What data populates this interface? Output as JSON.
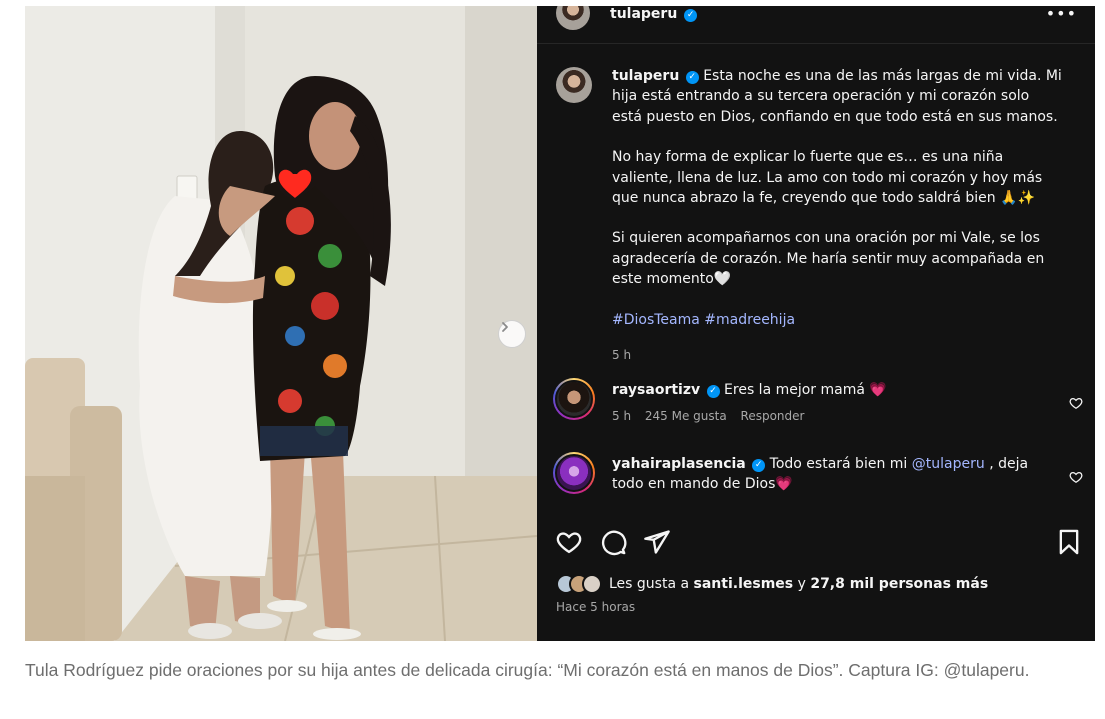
{
  "post": {
    "username": "tulaperu",
    "more_icon": "more-horizontal-icon",
    "caption": {
      "p1": "Esta noche es una de las más largas de mi vida. Mi hija está entrando a su tercera operación y mi corazón solo está puesto en Dios, confiando en que todo está en sus manos.",
      "p2": "No hay forma de explicar lo fuerte que es… es una niña valiente, llena de luz. La amo con todo mi corazón y hoy más que nunca abrazo la fe, creyendo que todo saldrá bien 🙏✨",
      "p3": "Si quieren acompañarnos con una oración por mi Vale, se los agradecería de corazón. Me haría sentir muy acompañada en este momento🤍",
      "hashtag1": "#DiosTeama",
      "hashtag2": "#madreehija",
      "time": "5 h"
    },
    "comments": [
      {
        "username": "raysaortizv",
        "text": "Eres la mejor mamá 💗",
        "time": "5 h",
        "likes": "245 Me gusta",
        "reply": "Responder"
      },
      {
        "username": "yahairaplasencia",
        "text_before": "Todo estará bien mi",
        "mention": "@tulaperu",
        "text_after": ", deja todo en mando de Dios💗"
      }
    ],
    "likes_prefix": "Les gusta a",
    "likes_user": "santi.lesmes",
    "likes_middle": "y",
    "likes_count": "27,8 mil personas más",
    "time_ago": "Hace 5 horas"
  },
  "figcaption": "Tula Rodríguez pide oraciones por su hija antes de delicada cirugía: “Mi corazón está en manos de Dios”. Captura IG: @tulaperu.",
  "colors": {
    "panel_bg": "#121212",
    "text": "#f5f5f5",
    "muted": "#a8a8a8",
    "link": "#a4b7ff",
    "verified": "#0095f6",
    "caption_gray": "#6e6e6e"
  },
  "icons": [
    "heart-icon",
    "comment-icon",
    "share-icon",
    "bookmark-icon",
    "chevron-right-icon",
    "verified-icon"
  ]
}
